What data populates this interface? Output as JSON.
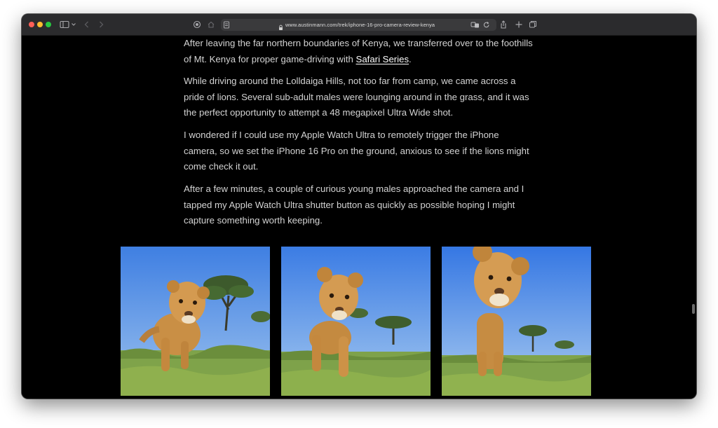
{
  "browser": {
    "url": "www.austinmann.com/trek/iphone-16-pro-camera-review-kenya"
  },
  "article": {
    "p1_before_link": "After leaving the far northern boundaries of Kenya, we transferred over to the foothills of Mt. Kenya for proper game-driving with ",
    "p1_link": "Safari Series",
    "p1_after_link": ".",
    "p2": "While driving around the Lolldaiga Hills, not too far from camp, we came across a pride of lions. Several sub-adult males were lounging around in the grass, and it was the perfect opportunity to attempt a 48 megapixel Ultra Wide shot.",
    "p3": "I wondered if I could use my Apple Watch Ultra to remotely trigger the iPhone camera, so we set the iPhone 16 Pro on the ground, anxious to see if the lions might come check it out.",
    "p4": "After a few minutes, a couple of curious young males approached the camera and I tapped my Apple Watch Ultra shutter button as quickly as possible hoping I might capture something worth keeping."
  },
  "gallery": {
    "images": [
      {
        "subject": "lion-walking-toward-camera"
      },
      {
        "subject": "lion-approaching-camera"
      },
      {
        "subject": "lion-closeup-looking-down"
      }
    ]
  },
  "colors": {
    "page_bg": "#000000",
    "body_text": "#d3d3d3",
    "link": "#ffffff",
    "sky": "#5a8fe0",
    "grass": "#7fa34a"
  }
}
